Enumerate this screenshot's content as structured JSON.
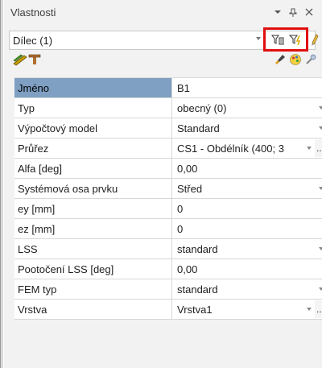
{
  "window": {
    "title": "Vlastnosti",
    "buttons": {
      "dropdown_icon": "chevron-down-icon",
      "pin_icon": "pin-icon",
      "close_icon": "close-icon"
    }
  },
  "selector": {
    "value": "Dílec (1)"
  },
  "toolbar": {
    "left": [
      "members-icon",
      "beam-icon"
    ],
    "right": [
      "brush-icon",
      "palette-icon",
      "tools-icon"
    ]
  },
  "colors": {
    "highlight_border": "#e01010",
    "selected_row": "#7f9fc3"
  },
  "properties": [
    {
      "name": "Jméno",
      "value": "B1",
      "control": "text",
      "selected": true
    },
    {
      "name": "Typ",
      "value": "obecný (0)",
      "control": "dropdown"
    },
    {
      "name": "Výpočtový model",
      "value": "Standard",
      "control": "dropdown"
    },
    {
      "name": "Průřez",
      "value": "CS1 - Obdélník (400; 3",
      "control": "dropdown-ellipsis"
    },
    {
      "name": "Alfa [deg]",
      "value": "0,00",
      "control": "text"
    },
    {
      "name": "Systémová osa prvku",
      "value": "Střed",
      "control": "dropdown"
    },
    {
      "name": "ey [mm]",
      "value": "0",
      "control": "text"
    },
    {
      "name": "ez [mm]",
      "value": "0",
      "control": "text"
    },
    {
      "name": "LSS",
      "value": "standard",
      "control": "dropdown"
    },
    {
      "name": "Pootočení LSS [deg]",
      "value": "0,00",
      "control": "text"
    },
    {
      "name": "FEM typ",
      "value": "standard",
      "control": "dropdown"
    },
    {
      "name": "Vrstva",
      "value": "Vrstva1",
      "control": "dropdown-ellipsis"
    }
  ]
}
